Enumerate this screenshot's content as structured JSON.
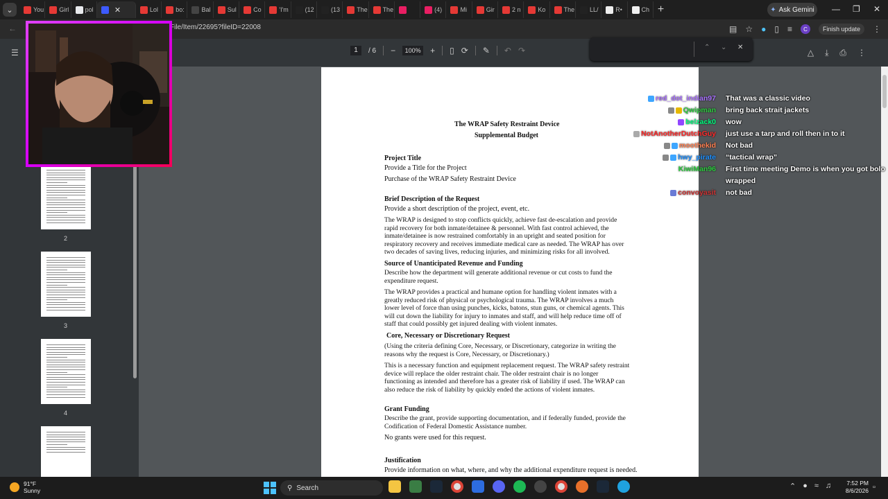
{
  "browser": {
    "tabs": [
      {
        "label": "You",
        "color": "#e53935"
      },
      {
        "label": "Girl",
        "color": "#e53935"
      },
      {
        "label": "pol",
        "color": "#e8eaed"
      },
      {
        "label": "",
        "color": "#3d5afe",
        "active": true
      },
      {
        "label": "Lol",
        "color": "#e53935"
      },
      {
        "label": "bo:",
        "color": "#e53935"
      },
      {
        "label": "Bal",
        "color": "#444"
      },
      {
        "label": "Sul",
        "color": "#e53935"
      },
      {
        "label": "Co",
        "color": "#e53935"
      },
      {
        "label": "'I'm",
        "color": "#e53935"
      },
      {
        "label": "(12",
        "color": "#222"
      },
      {
        "label": "(13",
        "color": "#222"
      },
      {
        "label": "The",
        "color": "#e53935"
      },
      {
        "label": "The",
        "color": "#e53935"
      },
      {
        "label": "",
        "color": "#e91e63"
      },
      {
        "label": "(4)",
        "color": "#e91e63"
      },
      {
        "label": "Mi",
        "color": "#e53935"
      },
      {
        "label": "Gir",
        "color": "#e53935"
      },
      {
        "label": "2 n",
        "color": "#e53935"
      },
      {
        "label": "Ko",
        "color": "#e53935"
      },
      {
        "label": "The",
        "color": "#e53935"
      },
      {
        "label": "LL/",
        "color": "#222"
      },
      {
        "label": "R•",
        "color": "#eee"
      },
      {
        "label": "Ch",
        "color": "#eee"
      }
    ],
    "ask_gemini": "Ask Gemini",
    "url": "vFile/Item/22695?fileID=22008",
    "finish_update": "Finish update",
    "profile_initial": "C"
  },
  "pdf": {
    "page_current": "1",
    "page_total": "/ 6",
    "zoom": "100%",
    "thumbnail_numbers": [
      "2",
      "3",
      "4"
    ],
    "title_line1": "The WRAP Safety Restraint Device",
    "title_line2": "Supplemental Budget",
    "project_title_heading": "Project Title",
    "project_title_prompt": "Provide a Title for the Project",
    "project_title_value": "Purchase of the WRAP Safety Restraint Device",
    "brief_heading": "Brief Description of the Request",
    "brief_prompt": "Provide a short description of the project, event, etc.",
    "brief_body": "The WRAP is designed to stop conflicts quickly, achieve fast de-escalation and provide rapid recovery for both inmate/detainee & personnel. With fast control achieved, the inmate/detainee is now restrained comfortably in an upright and seated position for respiratory recovery and receives immediate medical care as needed. The WRAP has over two decades of saving lives, reducing injuries, and minimizing risks for all involved.",
    "source_heading": "Source of Unanticipated Revenue and Funding",
    "source_prompt": "Describe how the department will generate additional revenue or cut costs to fund the expenditure request.",
    "source_body": "The WRAP provides a practical and humane option for handling violent inmates with a greatly reduced risk of physical or psychological trauma. The WRAP involves a much lower level of force than using punches, kicks, batons, stun guns, or chemical agents. This will cut down the liability for injury to inmates and staff, and will help reduce time off of staff that could possibly get injured dealing with violent inmates.",
    "core_heading": "Core, Necessary or Discretionary Request",
    "core_prompt": "(Using the criteria defining Core, Necessary, or Discretionary, categorize in writing the reasons why the request is Core, Necessary, or Discretionary.)",
    "core_body": "This is a necessary function and equipment replacement request.  The WRAP safety restraint device will replace the older restraint chair.  The older restraint chair is no longer functioning as intended and therefore has a greater risk of liability if used.  The WRAP can also reduce the risk of liability by quickly ended the actions of violent inmates.",
    "grant_heading": "Grant Funding",
    "grant_prompt": "Describe the grant, provide supporting documentation, and if federally funded, provide the Codification of Federal Domestic Assistance number.",
    "grant_body": "No grants were used for this request.",
    "justification_heading": "Justification",
    "justification_prompt": "Provide information on what, where, and why the additional expenditure request is needed."
  },
  "chat": [
    {
      "user": "red_dot_indian97",
      "color": "#a970ff",
      "msg": "That was a classic video",
      "badges": [
        "#3ea6ff"
      ]
    },
    {
      "user": "Qwipman",
      "color": "#2ecc40",
      "msg": "bring back strait jackets",
      "badges": [
        "#888",
        "#e6b800"
      ]
    },
    {
      "user": "belzack0",
      "color": "#00ff7f",
      "msg": "wow",
      "badges": [
        "#9146ff"
      ]
    },
    {
      "user": "NotAnotherDutchGuy",
      "color": "#ff2a2a",
      "msg": "just use a tarp and roll then in to it",
      "badges": [
        "#aaa"
      ]
    },
    {
      "user": "moothekid",
      "color": "#ff7f50",
      "msg": "Not bad",
      "badges": [
        "#888",
        "#3ea6ff"
      ]
    },
    {
      "user": "hwy_pirate",
      "color": "#1e90ff",
      "msg": "“tactical wrap”",
      "badges": [
        "#888",
        "#3ea6ff"
      ]
    },
    {
      "user": "KiwiMan96",
      "color": "#2ecc40",
      "msg": "First time meeting Demo is when you got bolo",
      "badges": []
    },
    {
      "user": "",
      "color": "#fff",
      "msg": "wrapped",
      "badges": []
    },
    {
      "user": "convoyasit",
      "color": "#cc3333",
      "msg": "not bad",
      "badges": [
        "#6a7bd6"
      ]
    }
  ],
  "taskbar": {
    "temp": "91°F",
    "condition": "Sunny",
    "search_placeholder": "Search",
    "time": "7:52 PM",
    "date": "8/6/2026"
  },
  "icons": {
    "back": "arrow-left-icon",
    "menu": "hamburger-icon",
    "zoom_out": "minus-icon",
    "zoom_in": "plus-icon",
    "download": "download-icon",
    "print": "print-icon",
    "more": "more-vert-icon"
  }
}
